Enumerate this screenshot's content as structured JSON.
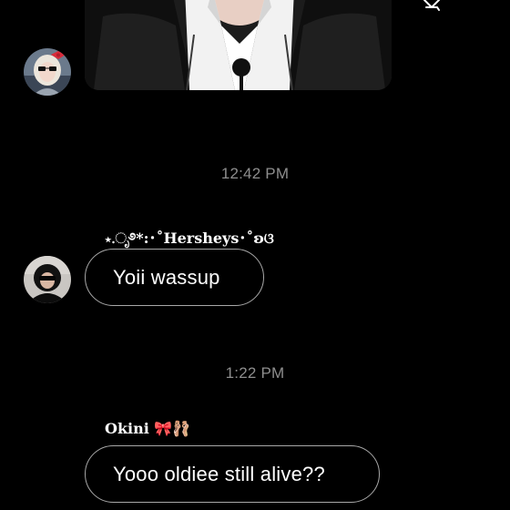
{
  "thread": {
    "messages": [
      {
        "type": "photo",
        "attachment_icon": "share-icon"
      },
      {
        "type": "timestamp",
        "text": "12:42 PM"
      },
      {
        "type": "text",
        "sender": "⋆.ೃ࿔*:･˚Hersheys･˚ʚଓ",
        "text": "Yoii wassup"
      },
      {
        "type": "timestamp",
        "text": "1:22 PM"
      },
      {
        "type": "text",
        "sender": "Okini 🎀🩰",
        "text": "Yooo oldiee still alive??"
      }
    ]
  },
  "colors": {
    "background": "#000000",
    "bubble_border": "#a8a8a8",
    "timestamp": "#8e8e8e",
    "text": "#ffffff"
  }
}
